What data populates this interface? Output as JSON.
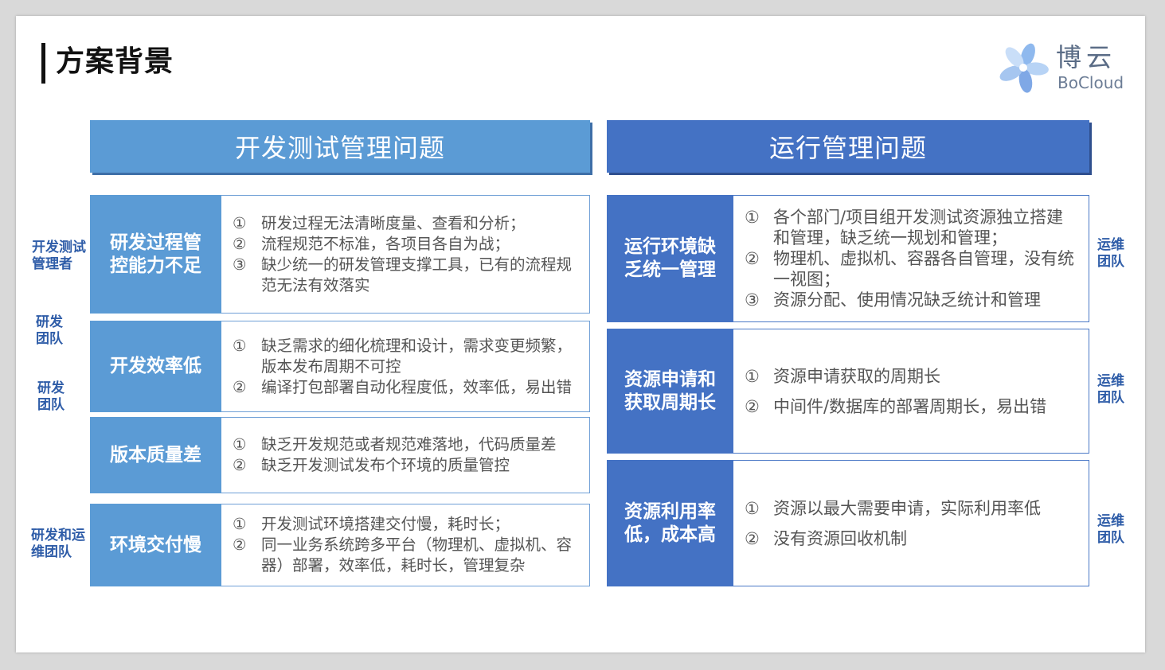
{
  "page": {
    "title": "方案背景",
    "logo": {
      "cn": "博云",
      "en": "BoCloud"
    }
  },
  "left": {
    "header": "开发测试管理问题",
    "rows": [
      {
        "label": "研发过程管控能力不足",
        "items": [
          {
            "num": "①",
            "text": "研发过程无法清晰度量、查看和分析；"
          },
          {
            "num": "②",
            "text": "流程规范不标准，各项目各自为战；"
          },
          {
            "num": "③",
            "text": "缺少统一的研发管理支撑工具，已有的流程规范无法有效落实"
          }
        ]
      },
      {
        "label": "开发效率低",
        "items": [
          {
            "num": "①",
            "text": "缺乏需求的细化梳理和设计，需求变更频繁，版本发布周期不可控"
          },
          {
            "num": "②",
            "text": "编译打包部署自动化程度低，效率低，易出错"
          }
        ]
      },
      {
        "label": "版本质量差",
        "items": [
          {
            "num": "①",
            "text": "缺乏开发规范或者规范难落地，代码质量差"
          },
          {
            "num": "②",
            "text": "缺乏开发测试发布个环境的质量管控"
          }
        ]
      },
      {
        "label": "环境交付慢",
        "items": [
          {
            "num": "①",
            "text": "开发测试环境搭建交付慢，耗时长；"
          },
          {
            "num": "②",
            "text": "同一业务系统跨多平台（物理机、虚拟机、容器）部署，效率低，耗时长，管理复杂"
          }
        ]
      }
    ],
    "side_labels": [
      "开发测试管理者",
      "研发团队",
      "研发团队",
      "研发和运维团队"
    ]
  },
  "right": {
    "header": "运行管理问题",
    "rows": [
      {
        "label": "运行环境缺乏统一管理",
        "items": [
          {
            "num": "①",
            "text": "各个部门/项目组开发测试资源独立搭建和管理，缺乏统一规划和管理；"
          },
          {
            "num": "②",
            "text": "物理机、虚拟机、容器各自管理，没有统一视图；"
          },
          {
            "num": "③",
            "text": "资源分配、使用情况缺乏统计和管理"
          }
        ]
      },
      {
        "label": "资源申请和获取周期长",
        "items": [
          {
            "num": "①",
            "text": "资源申请获取的周期长"
          },
          {
            "num": "②",
            "text": "中间件/数据库的部署周期长，易出错"
          }
        ]
      },
      {
        "label": "资源利用率低，成本高",
        "items": [
          {
            "num": "①",
            "text": "资源以最大需要申请，实际利用率低"
          },
          {
            "num": "②",
            "text": "没有资源回收机制"
          }
        ]
      }
    ],
    "side_labels": [
      "运维团队",
      "运维团队",
      "运维团队"
    ]
  }
}
